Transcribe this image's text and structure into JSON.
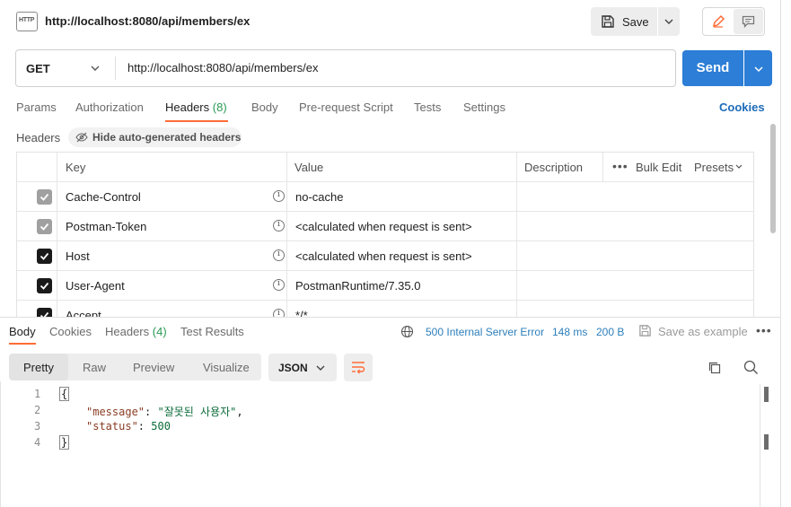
{
  "request": {
    "title_url": "http://localhost:8080/api/members/ex",
    "method": "GET",
    "url": "http://localhost:8080/api/members/ex",
    "send_label": "Send",
    "save_label": "Save",
    "http_badge": "HTTP"
  },
  "request_tabs": {
    "params": "Params",
    "authorization": "Authorization",
    "headers": "Headers",
    "headers_count": "(8)",
    "body": "Body",
    "prerequest": "Pre-request Script",
    "tests": "Tests",
    "settings": "Settings",
    "cookies": "Cookies"
  },
  "headers_section": {
    "label": "Headers",
    "hide_auto": "Hide auto-generated headers",
    "columns": {
      "key": "Key",
      "value": "Value",
      "description": "Description"
    },
    "bulk_edit": "Bulk Edit",
    "presets": "Presets",
    "more": "•••",
    "rows": [
      {
        "key": "Cache-Control",
        "value": "no-cache",
        "checked": "grey"
      },
      {
        "key": "Postman-Token",
        "value": "<calculated when request is sent>",
        "checked": "grey"
      },
      {
        "key": "Host",
        "value": "<calculated when request is sent>",
        "checked": "black"
      },
      {
        "key": "User-Agent",
        "value": "PostmanRuntime/7.35.0",
        "checked": "black"
      },
      {
        "key": "Accept",
        "value": "*/*",
        "checked": "black"
      }
    ]
  },
  "response": {
    "tabs": {
      "body": "Body",
      "cookies": "Cookies",
      "headers": "Headers",
      "headers_count": "(4)",
      "test_results": "Test Results"
    },
    "status": "500 Internal Server Error",
    "time": "148 ms",
    "size": "200 B",
    "save_example": "Save as example",
    "more": "•••",
    "views": {
      "pretty": "Pretty",
      "raw": "Raw",
      "preview": "Preview",
      "visualize": "Visualize"
    },
    "format": "JSON",
    "lines": [
      "1",
      "2",
      "3",
      "4"
    ],
    "code": {
      "open": "{",
      "key_message": "\"message\"",
      "val_message": "\"잘못된 사용자\"",
      "key_status": "\"status\"",
      "val_status": "500",
      "close": "}"
    }
  },
  "colors": {
    "accent": "#ff6c37",
    "send": "#2c7ed6",
    "status": "#2d7fbb",
    "link": "#1e6bb8"
  }
}
